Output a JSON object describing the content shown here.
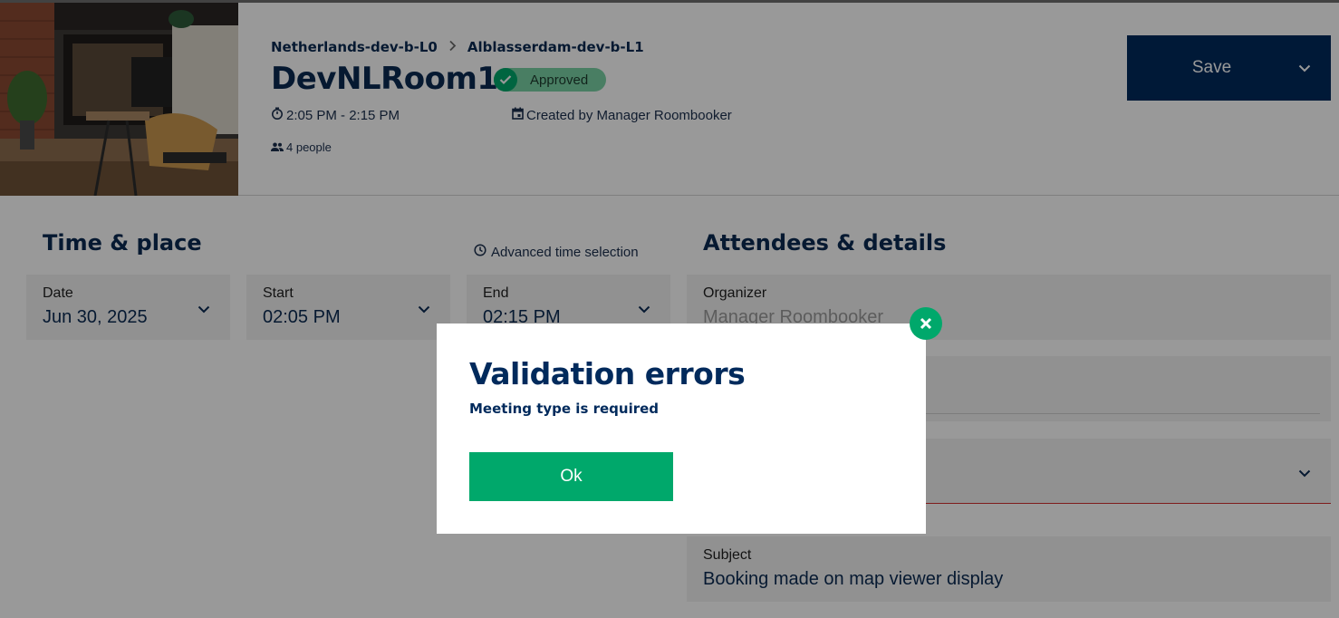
{
  "header": {
    "breadcrumb": [
      "Netherlands-dev-b-L0",
      "Alblasserdam-dev-b-L1"
    ],
    "room_name": "DevNLRoom1",
    "status": "Approved",
    "time_range": "2:05 PM - 2:15 PM",
    "created_by": "Created by Manager Roombooker",
    "capacity": "4 people",
    "save_label": "Save"
  },
  "time_place": {
    "title": "Time & place",
    "advanced_link": "Advanced time selection",
    "date": {
      "label": "Date",
      "value": "Jun 30, 2025"
    },
    "start": {
      "label": "Start",
      "value": "02:05 PM"
    },
    "end": {
      "label": "End",
      "value": "02:15 PM"
    }
  },
  "attendees": {
    "title": "Attendees & details",
    "organizer": {
      "label": "Organizer",
      "value": "Manager Roombooker"
    },
    "subject": {
      "label": "Subject",
      "value": "Booking made on map viewer display"
    }
  },
  "modal": {
    "title": "Validation errors",
    "message": "Meeting type is required",
    "ok_label": "Ok"
  },
  "colors": {
    "navy": "#002a5c",
    "green": "#00a86b",
    "badge": "#7bd2a6",
    "error_line": "#d32f2f"
  },
  "icons": [
    "chevron-right-icon",
    "check-icon",
    "timer-icon",
    "calendar-icon",
    "people-icon",
    "chevron-down-icon",
    "clock-icon",
    "close-icon"
  ]
}
